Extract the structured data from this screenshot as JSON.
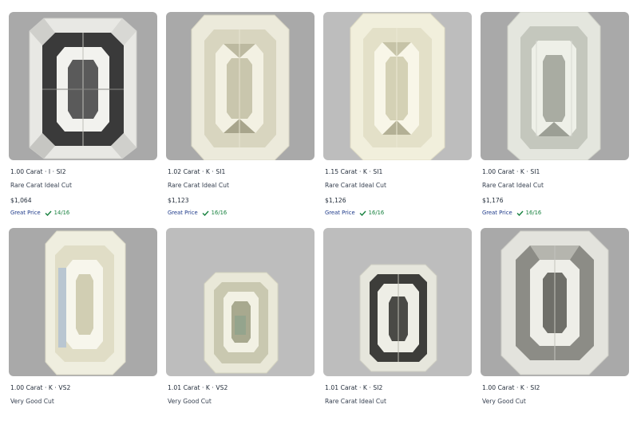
{
  "colors": {
    "great_price": "#1e3a8a",
    "score": "#15803d",
    "thumb_bg": "#a9a9a9"
  },
  "products": [
    {
      "title": "1.00 Carat · I · SI2",
      "cut": "Rare Carat Ideal Cut",
      "price": "$1,064",
      "badge": "Great Price",
      "score": "14/16",
      "icon": "emerald-cut-diamond-image"
    },
    {
      "title": "1.02 Carat · K · SI1",
      "cut": "Rare Carat Ideal Cut",
      "price": "$1,123",
      "badge": "Great Price",
      "score": "16/16",
      "icon": "emerald-cut-diamond-image"
    },
    {
      "title": "1.15 Carat · K · SI1",
      "cut": "Rare Carat Ideal Cut",
      "price": "$1,126",
      "badge": "Great Price",
      "score": "16/16",
      "icon": "emerald-cut-diamond-image"
    },
    {
      "title": "1.00 Carat · K · SI1",
      "cut": "Rare Carat Ideal Cut",
      "price": "$1,176",
      "badge": "Great Price",
      "score": "16/16",
      "icon": "emerald-cut-diamond-image"
    },
    {
      "title": "1.00 Carat · K · VS2",
      "cut": "Very Good Cut",
      "icon": "emerald-cut-diamond-image"
    },
    {
      "title": "1.01 Carat · K · VS2",
      "cut": "Very Good Cut",
      "icon": "emerald-cut-diamond-image"
    },
    {
      "title": "1.01 Carat · K · SI2",
      "cut": "Rare Carat Ideal Cut",
      "icon": "emerald-cut-diamond-image"
    },
    {
      "title": "1.00 Carat · K · SI2",
      "cut": "Very Good Cut",
      "icon": "emerald-cut-diamond-image"
    }
  ]
}
